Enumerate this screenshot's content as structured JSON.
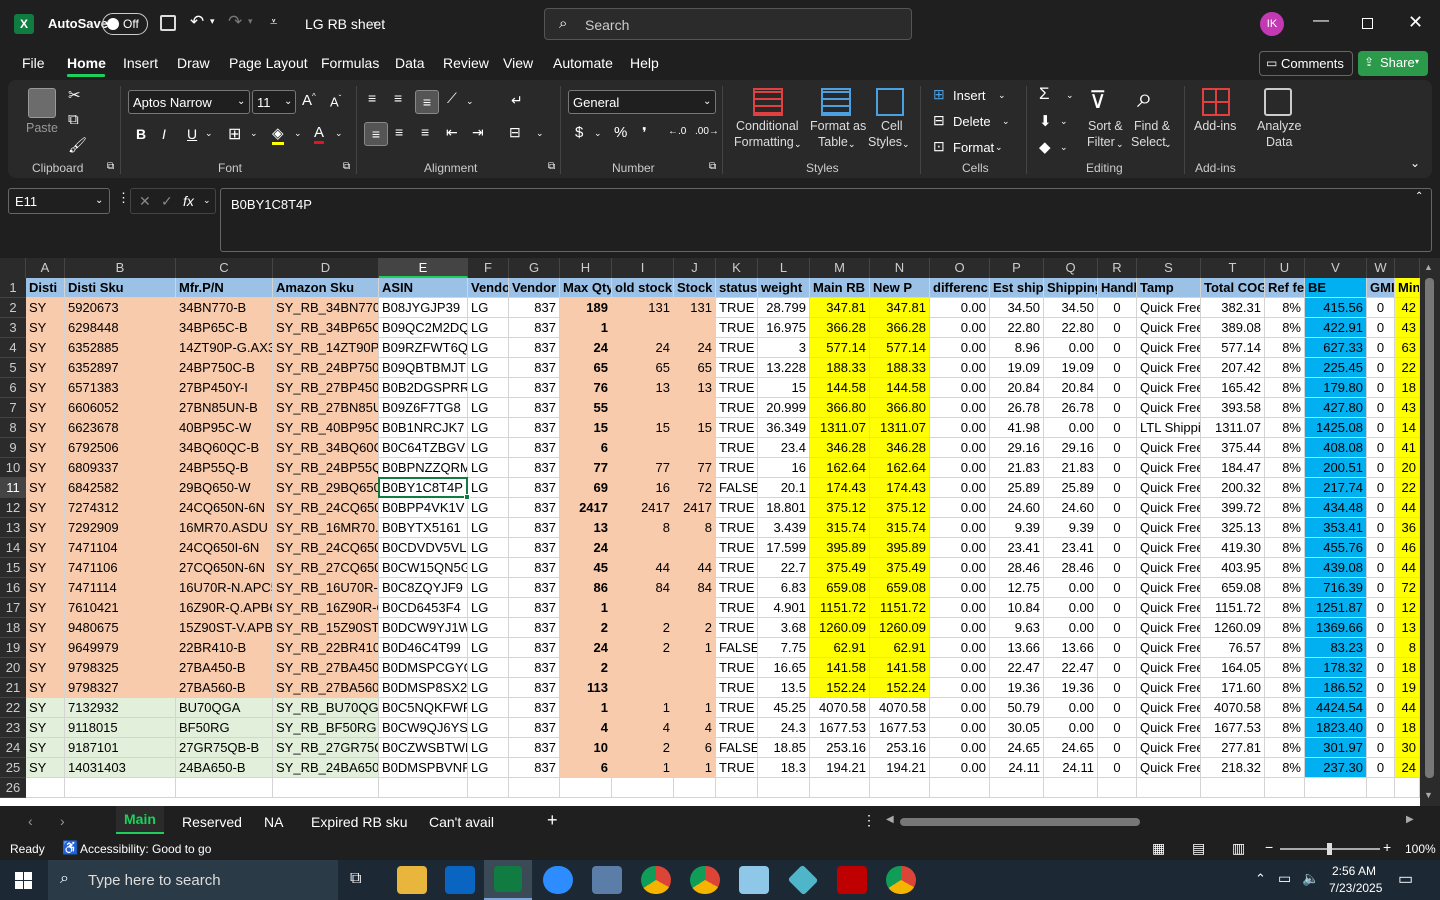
{
  "titlebar": {
    "autosave_label": "AutoSave",
    "autosave_state": "Off",
    "doc_title": "LG RB sheet",
    "search_placeholder": "Search",
    "user_initials": "IK"
  },
  "menu": [
    "File",
    "Home",
    "Insert",
    "Draw",
    "Page Layout",
    "Formulas",
    "Data",
    "Review",
    "View",
    "Automate",
    "Help"
  ],
  "menu_active": "Home",
  "menu_right": {
    "comments": "Comments",
    "share": "Share"
  },
  "ribbon": {
    "clipboard": {
      "paste": "Paste",
      "group": "Clipboard"
    },
    "font": {
      "name": "Aptos Narrow",
      "size": "11",
      "group": "Font",
      "bold": "B",
      "italic": "I",
      "underline": "U"
    },
    "alignment": {
      "group": "Alignment"
    },
    "number": {
      "format": "General",
      "group": "Number"
    },
    "styles": {
      "cond_l1": "Conditional",
      "cond_l2": "Formatting",
      "fmt_l1": "Format as",
      "fmt_l2": "Table",
      "cell_l1": "Cell",
      "cell_l2": "Styles",
      "group": "Styles"
    },
    "cells": {
      "insert": "Insert",
      "delete": "Delete",
      "format": "Format",
      "group": "Cells"
    },
    "editing": {
      "sort_l1": "Sort &",
      "sort_l2": "Filter",
      "find_l1": "Find &",
      "find_l2": "Select",
      "group": "Editing"
    },
    "addins": {
      "addins": "Add-ins",
      "analyze_l1": "Analyze",
      "analyze_l2": "Data",
      "group": "Add-ins"
    }
  },
  "formula_bar": {
    "name_box": "E11",
    "fx": "fx",
    "content": "B0BY1C8T4P"
  },
  "columns": [
    "A",
    "B",
    "C",
    "D",
    "E",
    "F",
    "G",
    "H",
    "I",
    "J",
    "K",
    "L",
    "M",
    "N",
    "O",
    "P",
    "Q",
    "R",
    "S",
    "T",
    "U",
    "V",
    "W",
    ""
  ],
  "header_row": [
    "Disti",
    "Disti Sku",
    "Mfr.P/N",
    "Amazon Sku",
    "ASIN",
    "Vendo",
    "Vendor",
    "Max Qty",
    "old stock",
    "Stock",
    "status",
    "weight",
    "Main RB F",
    "New P",
    "differenc",
    "Est ship",
    "Shipping",
    "Handl",
    "Tamp",
    "Total COG",
    "Ref fe",
    "BE",
    "GMI",
    "Min"
  ],
  "rows": [
    [
      "SY",
      "5920673",
      "34BN770-B",
      "SY_RB_34BN770-I",
      "B08JYGJP39",
      "LG",
      "837",
      "189",
      "131",
      "131",
      "TRUE",
      "28.799",
      "347.81",
      "347.81",
      "0.00",
      "34.50",
      "34.50",
      "0",
      "Quick Free",
      "382.31",
      "8%",
      "415.56",
      "0",
      "42"
    ],
    [
      "SY",
      "6298448",
      "34BP65C-B",
      "SY_RB_34BP65C-E",
      "B09QC2M2DQ",
      "LG",
      "837",
      "1",
      "",
      "",
      "TRUE",
      "16.975",
      "366.28",
      "366.28",
      "0.00",
      "22.80",
      "22.80",
      "0",
      "Quick Free",
      "389.08",
      "8%",
      "422.91",
      "0",
      "43"
    ],
    [
      "SY",
      "6352885",
      "14ZT90P-G.AX33",
      "SY_RB_14ZT90P-G",
      "B09RZFWT6Q",
      "LG",
      "837",
      "24",
      "24",
      "24",
      "TRUE",
      "3",
      "577.14",
      "577.14",
      "0.00",
      "8.96",
      "0.00",
      "0",
      "Quick Free",
      "577.14",
      "8%",
      "627.33",
      "0",
      "63"
    ],
    [
      "SY",
      "6352897",
      "24BP750C-B",
      "SY_RB_24BP750C",
      "B09QBTBMJT",
      "LG",
      "837",
      "65",
      "65",
      "65",
      "TRUE",
      "13.228",
      "188.33",
      "188.33",
      "0.00",
      "19.09",
      "19.09",
      "0",
      "Quick Free",
      "207.42",
      "8%",
      "225.45",
      "0",
      "22"
    ],
    [
      "SY",
      "6571383",
      "27BP450Y-I",
      "SY_RB_27BP450Y-",
      "B0B2DGSPRR",
      "LG",
      "837",
      "76",
      "13",
      "13",
      "TRUE",
      "15",
      "144.58",
      "144.58",
      "0.00",
      "20.84",
      "20.84",
      "0",
      "Quick Free",
      "165.42",
      "8%",
      "179.80",
      "0",
      "18"
    ],
    [
      "SY",
      "6606052",
      "27BN85UN-B",
      "SY_RB_27BN85UN",
      "B09Z6F7TG8",
      "LG",
      "837",
      "55",
      "",
      "",
      "TRUE",
      "20.999",
      "366.80",
      "366.80",
      "0.00",
      "26.78",
      "26.78",
      "0",
      "Quick Free",
      "393.58",
      "8%",
      "427.80",
      "0",
      "43"
    ],
    [
      "SY",
      "6623678",
      "40BP95C-W",
      "SY_RB_40BP95C-V",
      "B0B1NRCJK7",
      "LG",
      "837",
      "15",
      "15",
      "15",
      "TRUE",
      "36.349",
      "1311.07",
      "1311.07",
      "0.00",
      "41.98",
      "0.00",
      "0",
      "LTL Shippi",
      "1311.07",
      "8%",
      "1425.08",
      "0",
      "14"
    ],
    [
      "SY",
      "6792506",
      "34BQ60QC-B",
      "SY_RB_34BQ60QC",
      "B0C64TZBGV",
      "LG",
      "837",
      "6",
      "",
      "",
      "TRUE",
      "23.4",
      "346.28",
      "346.28",
      "0.00",
      "29.16",
      "29.16",
      "0",
      "Quick Free",
      "375.44",
      "8%",
      "408.08",
      "0",
      "41"
    ],
    [
      "SY",
      "6809337",
      "24BP55Q-B",
      "SY_RB_24BP55Q-",
      "B0BPNZZQRM",
      "LG",
      "837",
      "77",
      "77",
      "77",
      "TRUE",
      "16",
      "162.64",
      "162.64",
      "0.00",
      "21.83",
      "21.83",
      "0",
      "Quick Free",
      "184.47",
      "8%",
      "200.51",
      "0",
      "20"
    ],
    [
      "SY",
      "6842582",
      "29BQ650-W",
      "SY_RB_29BQ650-V",
      "B0BY1C8T4P",
      "LG",
      "837",
      "69",
      "16",
      "72",
      "FALSE",
      "20.1",
      "174.43",
      "174.43",
      "0.00",
      "25.89",
      "25.89",
      "0",
      "Quick Free",
      "200.32",
      "8%",
      "217.74",
      "0",
      "22"
    ],
    [
      "SY",
      "7274312",
      "24CQ650N-6N",
      "SY_RB_24CQ650N",
      "B0BPP4VK1V",
      "LG",
      "837",
      "2417",
      "2417",
      "2417",
      "TRUE",
      "18.801",
      "375.12",
      "375.12",
      "0.00",
      "24.60",
      "24.60",
      "0",
      "Quick Free",
      "399.72",
      "8%",
      "434.48",
      "0",
      "44"
    ],
    [
      "SY",
      "7292909",
      "16MR70.ASDU",
      "SY_RB_16MR70.A",
      "B0BYTX5161",
      "LG",
      "837",
      "13",
      "8",
      "8",
      "TRUE",
      "3.439",
      "315.74",
      "315.74",
      "0.00",
      "9.39",
      "9.39",
      "0",
      "Quick Free",
      "325.13",
      "8%",
      "353.41",
      "0",
      "36"
    ],
    [
      "SY",
      "7471104",
      "24CQ650I-6N",
      "SY_RB_24CQ650I-",
      "B0CDVDV5VL",
      "LG",
      "837",
      "24",
      "",
      "",
      "TRUE",
      "17.599",
      "395.89",
      "395.89",
      "0.00",
      "23.41",
      "23.41",
      "0",
      "Quick Free",
      "419.30",
      "8%",
      "455.76",
      "0",
      "46"
    ],
    [
      "SY",
      "7471106",
      "27CQ650N-6N",
      "SY_RB_27CQ650N",
      "B0CW15QN5G",
      "LG",
      "837",
      "45",
      "44",
      "44",
      "TRUE",
      "22.7",
      "375.49",
      "375.49",
      "0.00",
      "28.46",
      "28.46",
      "0",
      "Quick Free",
      "403.95",
      "8%",
      "439.08",
      "0",
      "44"
    ],
    [
      "SY",
      "7471114",
      "16U70R-N.APC5",
      "SY_RB_16U70R-N",
      "B0C8ZQYJF9",
      "LG",
      "837",
      "86",
      "84",
      "84",
      "TRUE",
      "6.83",
      "659.08",
      "659.08",
      "0.00",
      "12.75",
      "0.00",
      "0",
      "Quick Free",
      "659.08",
      "8%",
      "716.39",
      "0",
      "72"
    ],
    [
      "SY",
      "7610421",
      "16Z90R-Q.APB6",
      "SY_RB_16Z90R-Q.",
      "B0CD6453F4",
      "LG",
      "837",
      "1",
      "",
      "",
      "TRUE",
      "4.901",
      "1151.72",
      "1151.72",
      "0.00",
      "10.84",
      "0.00",
      "0",
      "Quick Free",
      "1151.72",
      "8%",
      "1251.87",
      "0",
      "12"
    ],
    [
      "SY",
      "9480675",
      "15Z90ST-V.APB6",
      "SY_RB_15Z90ST-V",
      "B0DCW9YJ1W",
      "LG",
      "837",
      "2",
      "2",
      "2",
      "TRUE",
      "3.68",
      "1260.09",
      "1260.09",
      "0.00",
      "9.63",
      "0.00",
      "0",
      "Quick Free",
      "1260.09",
      "8%",
      "1369.66",
      "0",
      "13"
    ],
    [
      "SY",
      "9649979",
      "22BR410-B",
      "SY_RB_22BR410-E",
      "B0D46C4T99",
      "LG",
      "837",
      "24",
      "2",
      "1",
      "FALSE",
      "7.75",
      "62.91",
      "62.91",
      "0.00",
      "13.66",
      "13.66",
      "0",
      "Quick Free",
      "76.57",
      "8%",
      "83.23",
      "0",
      "8"
    ],
    [
      "SY",
      "9798325",
      "27BA450-B",
      "SY_RB_27BA450-E",
      "B0DMSPCGYQ",
      "LG",
      "837",
      "2",
      "",
      "",
      "TRUE",
      "16.65",
      "141.58",
      "141.58",
      "0.00",
      "22.47",
      "22.47",
      "0",
      "Quick Free",
      "164.05",
      "8%",
      "178.32",
      "0",
      "18"
    ],
    [
      "SY",
      "9798327",
      "27BA560-B",
      "SY_RB_27BA560-E",
      "B0DMSP8SX2",
      "LG",
      "837",
      "113",
      "",
      "",
      "TRUE",
      "13.5",
      "152.24",
      "152.24",
      "0.00",
      "19.36",
      "19.36",
      "0",
      "Quick Free",
      "171.60",
      "8%",
      "186.52",
      "0",
      "19"
    ],
    [
      "SY",
      "7132932",
      "BU70QGA",
      "SY_RB_BU70QGA",
      "B0C5NQKFWP",
      "LG",
      "837",
      "1",
      "1",
      "1",
      "TRUE",
      "45.25",
      "4070.58",
      "4070.58",
      "0.00",
      "50.79",
      "0.00",
      "0",
      "Quick Free",
      "4070.58",
      "8%",
      "4424.54",
      "0",
      "44"
    ],
    [
      "SY",
      "9118015",
      "BF50RG",
      "SY_RB_BF50RG",
      "B0CW9QJ6YS",
      "LG",
      "837",
      "4",
      "4",
      "4",
      "TRUE",
      "24.3",
      "1677.53",
      "1677.53",
      "0.00",
      "30.05",
      "0.00",
      "0",
      "Quick Free",
      "1677.53",
      "8%",
      "1823.40",
      "0",
      "18"
    ],
    [
      "SY",
      "9187101",
      "27GR75QB-B",
      "SY_RB_27GR75QE",
      "B0CZWSBTWR",
      "LG",
      "837",
      "10",
      "2",
      "6",
      "FALSE",
      "18.85",
      "253.16",
      "253.16",
      "0.00",
      "24.65",
      "24.65",
      "0",
      "Quick Free",
      "277.81",
      "8%",
      "301.97",
      "0",
      "30"
    ],
    [
      "SY",
      "14031403",
      "24BA650-B",
      "SY_RB_24BA650-E",
      "B0DMSPBVNF",
      "LG",
      "837",
      "6",
      "1",
      "1",
      "TRUE",
      "18.3",
      "194.21",
      "194.21",
      "0.00",
      "24.11",
      "24.11",
      "0",
      "Quick Free",
      "218.32",
      "8%",
      "237.30",
      "0",
      "24"
    ]
  ],
  "row_numbers": [
    "1",
    "2",
    "3",
    "4",
    "5",
    "6",
    "7",
    "8",
    "9",
    "10",
    "11",
    "12",
    "13",
    "14",
    "15",
    "16",
    "17",
    "18",
    "19",
    "20",
    "21",
    "22",
    "23",
    "24",
    "25",
    "26"
  ],
  "colors": {
    "header_blue": "#9bc2e6",
    "pink": "#f8cbad",
    "yellow": "#ffff00",
    "blue_col": "#00b0f0",
    "green": "#e2efda",
    "excel_green": "#107c41",
    "share_green": "#2b9a4a"
  },
  "sheet_tabs": [
    "Main",
    "Reserved",
    "NA",
    "Expired RB sku",
    "Can't avail"
  ],
  "active_tab": "Main",
  "status": {
    "ready": "Ready",
    "accessibility": "Accessibility: Good to go",
    "zoom": "100%"
  },
  "taskbar": {
    "search_placeholder": "Type here to search",
    "time": "2:56 AM",
    "date": "7/23/2025"
  }
}
